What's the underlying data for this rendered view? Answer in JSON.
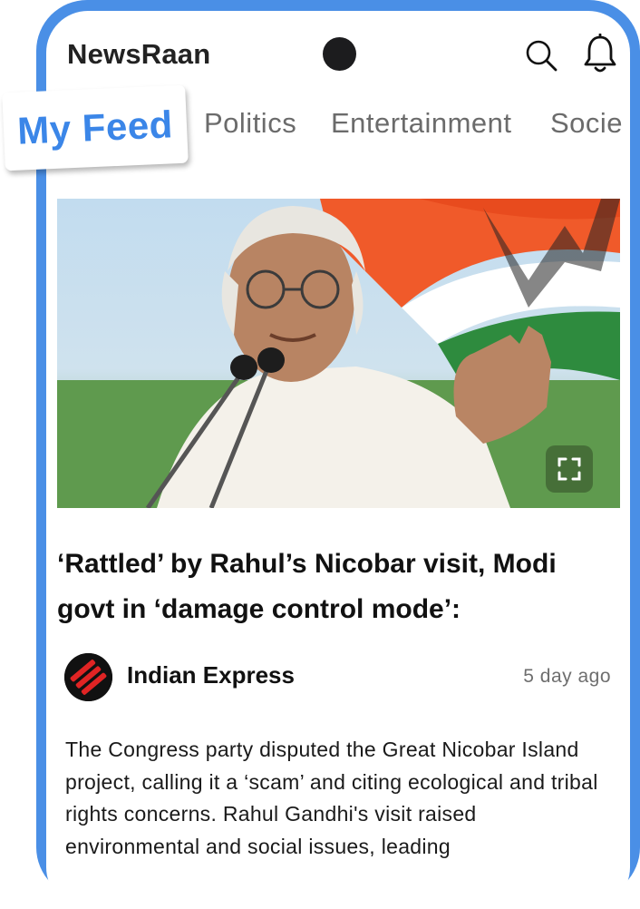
{
  "app": {
    "title": "NewsRaan"
  },
  "header": {
    "search_icon": "search-icon",
    "bell_icon": "bell-icon"
  },
  "tabs": [
    {
      "label": "My Feed",
      "active": true
    },
    {
      "label": "Politics"
    },
    {
      "label": "Entertainment"
    },
    {
      "label": "Socie"
    }
  ],
  "article": {
    "headline": "‘Rattled’ by Rahul’s Nicobar visit, Modi govt in ‘damage control mode’:",
    "source": "Indian Express",
    "time": "5 day ago",
    "body": "The Congress party disputed the Great Nicobar Island project, calling it a ‘scam’ and citing ecological and tribal rights concerns. Rahul Gandhi's visit raised environmental and social issues, leading"
  },
  "colors": {
    "frame": "#4a8fe6",
    "accent": "#3b86e8",
    "source_logo": "#e02424"
  }
}
